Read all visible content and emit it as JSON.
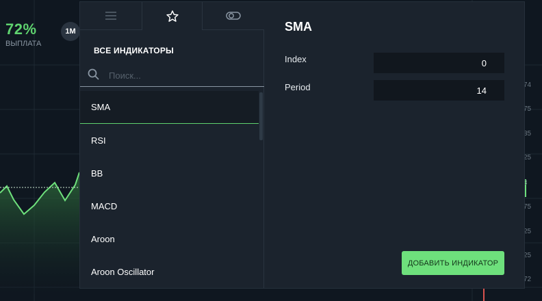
{
  "payout": {
    "percent": "72%",
    "label": "ВЫПЛАТА"
  },
  "timeframe_button": "1M",
  "right_scale": [
    "74",
    "75",
    "35",
    "25",
    "3",
    "75",
    "25",
    "25",
    "72"
  ],
  "panel": {
    "tabs": [
      {
        "icon": "hamburger-icon"
      },
      {
        "icon": "star-icon"
      },
      {
        "icon": "toggle-icon"
      }
    ],
    "section_title": "ВСЕ ИНДИКАТОРЫ",
    "search": {
      "placeholder": "Поиск...",
      "value": ""
    },
    "indicators": [
      "SMA",
      "RSI",
      "BB",
      "MACD",
      "Aroon",
      "Aroon Oscillator"
    ],
    "selected_indicator": "SMA"
  },
  "details": {
    "title": "SMA",
    "params": [
      {
        "label": "Index",
        "value": "0"
      },
      {
        "label": "Period",
        "value": "14"
      }
    ],
    "add_button_label": "ДОБАВИТЬ ИНДИКАТОР"
  },
  "colors": {
    "accent_green": "#6ee07c",
    "payout_green": "#5fd36f",
    "panel_bg": "#1b232d",
    "page_bg": "#0f1720"
  }
}
